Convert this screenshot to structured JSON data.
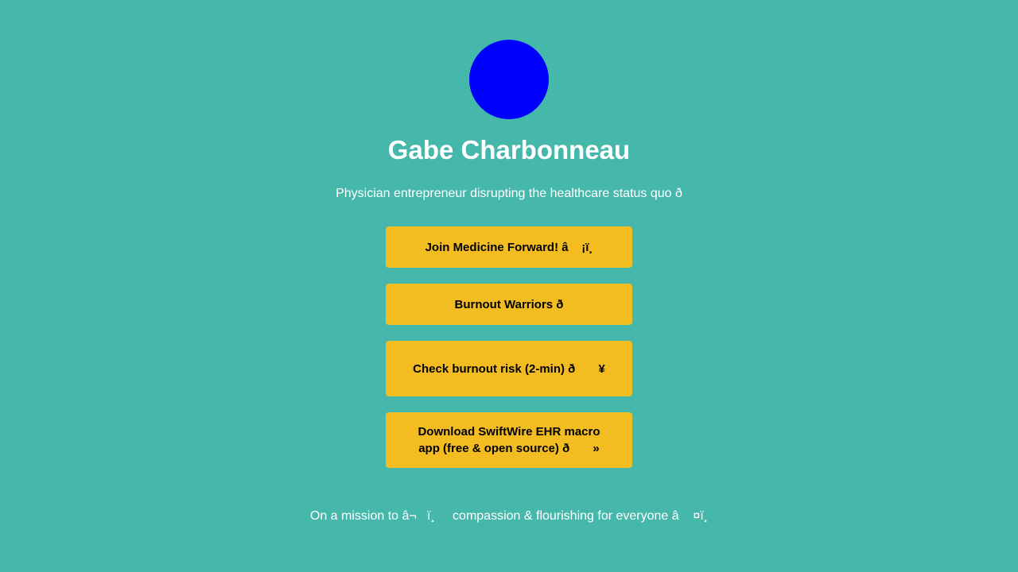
{
  "profile": {
    "name": "Gabe Charbonneau",
    "tagline": "Physician entrepreneur disrupting the healthcare status quo ð",
    "avatar_color": "#0000ff"
  },
  "links": [
    {
      "label": "Join Medicine Forward! â    ¡ï¸"
    },
    {
      "label": "Burnout Warriors ð"
    },
    {
      "label": "Check burnout risk (2-min) ð       ¥"
    },
    {
      "label": "Download SwiftWire EHR macro app (free & open source) ð       »"
    }
  ],
  "footer": {
    "mission": "On a mission to â¬   ï¸     compassion & flourishing for everyone â    ¤ï¸"
  },
  "colors": {
    "background": "#45b8ab",
    "button": "#f3bd22",
    "button_text": "#000000",
    "text": "#ffffff"
  }
}
